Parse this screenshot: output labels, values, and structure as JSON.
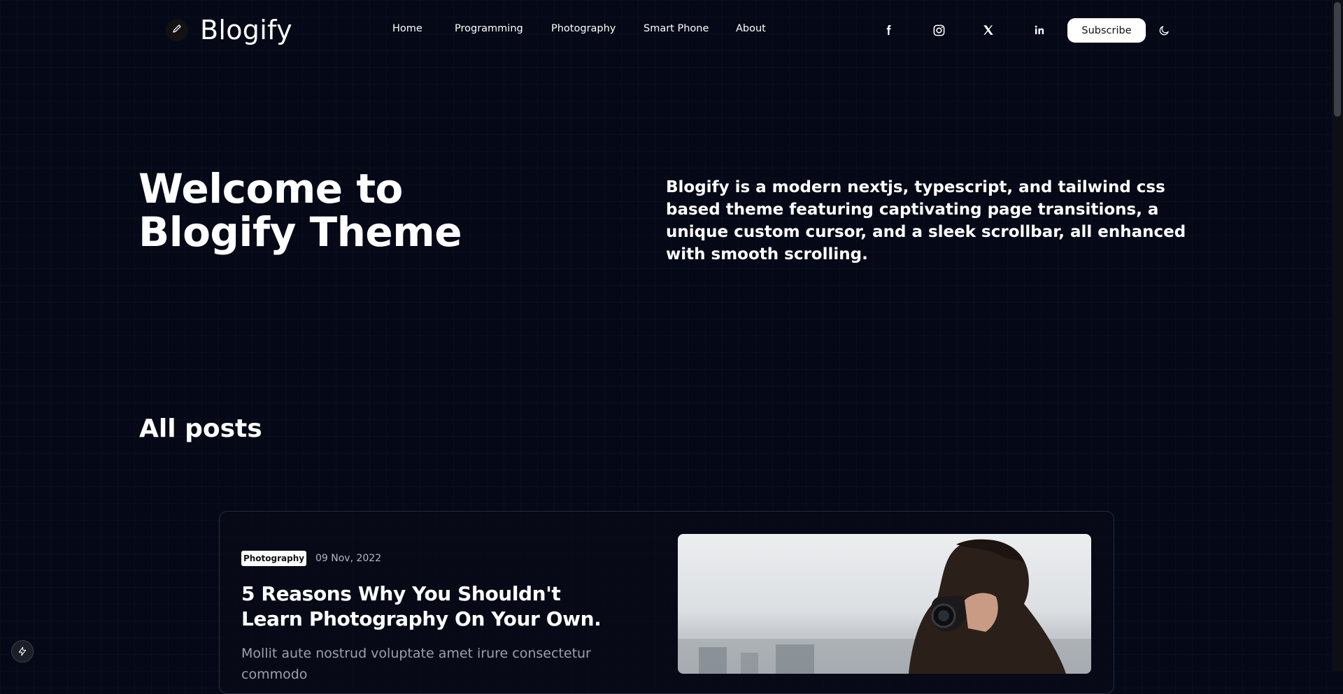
{
  "header": {
    "brand": "Blogify",
    "brand_icon": "pencil-icon",
    "nav": [
      {
        "label": "Home"
      },
      {
        "label": "Programming"
      },
      {
        "label": "Photography"
      },
      {
        "label": "Smart Phone"
      },
      {
        "label": "About"
      }
    ],
    "social_icons": [
      "facebook-icon",
      "instagram-icon",
      "x-icon",
      "linkedin-icon"
    ],
    "subscribe_label": "Subscribe",
    "theme_icon": "moon-icon"
  },
  "hero": {
    "title_line1": "Welcome to",
    "title_line2": "Blogify Theme",
    "description": "Blogify is a modern nextjs, typescript, and tailwind css based theme featuring captivating page transitions, a unique custom cursor, and a sleek scrollbar, all enhanced with smooth scrolling."
  },
  "posts": {
    "section_title": "All posts",
    "items": [
      {
        "category": "Photography",
        "date": "09 Nov, 2022",
        "title": "5 Reasons Why You Shouldn't Learn Photography On Your Own.",
        "excerpt": "Mollit aute nostrud voluptate amet irure consectetur commodo"
      }
    ]
  },
  "colors": {
    "background": "#050816",
    "text": "#ffffff",
    "muted_text": "#9ca0ac",
    "badge_bg": "#ffffff"
  },
  "floating_button_icon": "lightning-icon"
}
